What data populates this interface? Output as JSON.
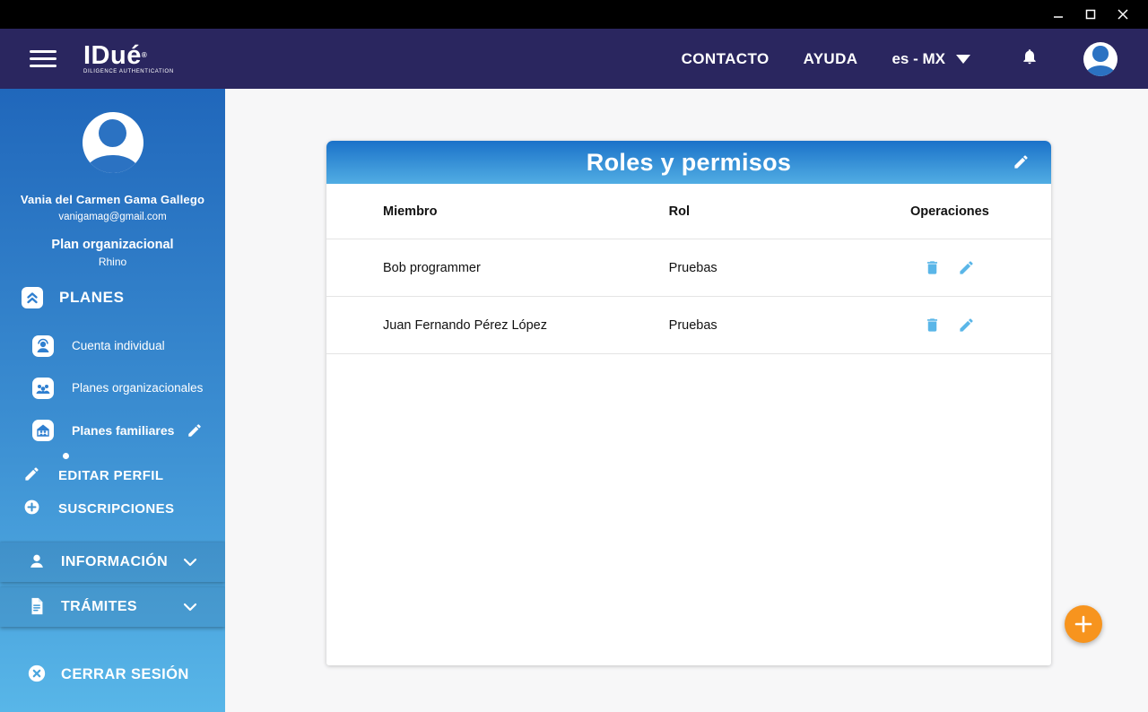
{
  "window": {
    "controls": [
      "minimize-icon",
      "maximize-icon",
      "close-icon"
    ]
  },
  "header": {
    "logo_text": "IDué",
    "logo_registered": "®",
    "logo_tagline": "DILIGENCE AUTHENTICATION",
    "nav": [
      {
        "label": "CONTACTO"
      },
      {
        "label": "AYUDA"
      }
    ],
    "language_selector": {
      "value": "es - MX",
      "icon": "caret-down-icon"
    },
    "icons": {
      "menu": "hamburger-icon",
      "notifications": "bell-icon",
      "profile": "avatar-icon"
    }
  },
  "sidebar": {
    "user": {
      "name": "Vania del Carmen Gama Gallego",
      "email": "vanigamag@gmail.com",
      "plan_type": "Plan organizacional",
      "plan_name": "Rhino"
    },
    "planes": {
      "label": "PLANES",
      "icon": "collapse-up-icon",
      "items": [
        {
          "label": "Cuenta individual",
          "icon": "individual-account-icon"
        },
        {
          "label": "Planes organizacionales",
          "icon": "organizational-plans-icon"
        },
        {
          "label": "Planes familiares",
          "icon": "family-plans-icon",
          "selected": true,
          "edit_icon": "pencil-icon"
        }
      ]
    },
    "edit_profile": {
      "label": "EDITAR PERFIL",
      "icon": "pencil-icon"
    },
    "subscriptions": {
      "label": "SUSCRIPCIONES",
      "icon": "plus-circle-icon"
    },
    "sections": [
      {
        "label": "INFORMACIÓN",
        "icon": "person-icon",
        "chevron": "chevron-down-icon"
      },
      {
        "label": "TRÁMITES",
        "icon": "document-icon",
        "chevron": "chevron-down-icon"
      }
    ],
    "logout": {
      "label": "CERRAR SESIÓN",
      "icon": "close-circle-icon"
    }
  },
  "main": {
    "card": {
      "title": "Roles y permisos",
      "edit_icon": "pencil-icon",
      "table": {
        "headers": [
          "Miembro",
          "Rol",
          "Operaciones"
        ],
        "rows": [
          {
            "member": "Bob programmer",
            "role": "Pruebas",
            "operations": [
              "delete-icon",
              "edit-icon"
            ]
          },
          {
            "member": "Juan Fernando Pérez López",
            "role": "Pruebas",
            "operations": [
              "delete-icon",
              "edit-icon"
            ]
          }
        ]
      }
    },
    "fab": {
      "icon": "plus-icon"
    }
  },
  "colors": {
    "titlebar": "#000000",
    "appbar": "#2a265f",
    "sidebar_gradient_top": "#2067bb",
    "sidebar_gradient_bottom": "#58b6e8",
    "card_header_gradient_top": "#1b72c9",
    "card_header_gradient_bottom": "#51ade3",
    "action_icon_blue": "#5ab6e8",
    "fab_orange": "#f7941e",
    "main_background": "#f7f7f8"
  }
}
